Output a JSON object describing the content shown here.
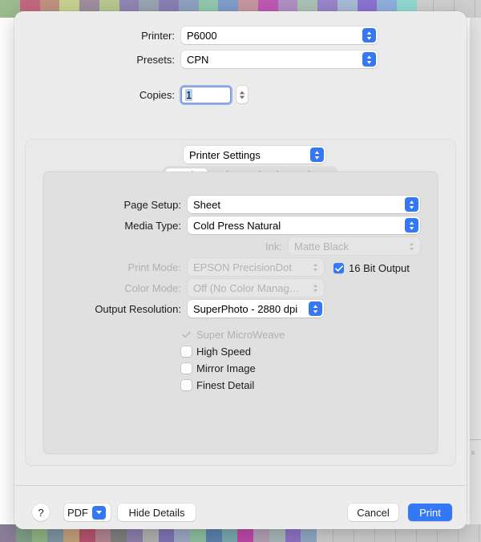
{
  "dialog": {
    "fields": [
      {
        "label": "Printer:",
        "value": "P6000",
        "enabled": true
      },
      {
        "label": "Presets:",
        "value": "CPN",
        "enabled": true
      }
    ],
    "copies": {
      "label": "Copies:",
      "value": "1"
    },
    "pane_selector": {
      "value": "Printer Settings"
    },
    "tabs": [
      {
        "label": "Basic",
        "selected": true
      },
      {
        "label": "Advanced Color Settings",
        "selected": false
      }
    ],
    "settings": [
      {
        "label": "Page Setup:",
        "value": "Sheet",
        "enabled": true
      },
      {
        "label": "Media Type:",
        "value": "Cold Press Natural",
        "enabled": true
      },
      {
        "label": "Ink:",
        "value": "Matte Black",
        "enabled": false
      },
      {
        "label": "Print Mode:",
        "value": "EPSON PrecisionDot",
        "enabled": false
      },
      {
        "label": "Color Mode:",
        "value": "Off (No Color Managem…",
        "enabled": false
      },
      {
        "label": "Output Resolution:",
        "value": "SuperPhoto - 2880 dpi",
        "enabled": true
      }
    ],
    "bit_output": {
      "label": "16 Bit Output",
      "checked": true,
      "enabled": true
    },
    "checkboxes": [
      {
        "label": "Super MicroWeave",
        "checked": true,
        "enabled": false
      },
      {
        "label": "High Speed",
        "checked": false,
        "enabled": true
      },
      {
        "label": "Mirror Image",
        "checked": false,
        "enabled": true
      },
      {
        "label": "Finest Detail",
        "checked": false,
        "enabled": true
      }
    ],
    "footer": {
      "help_label": "?",
      "pdf_label": "PDF",
      "details_label": "Hide Details",
      "cancel_label": "Cancel",
      "print_label": "Print"
    }
  },
  "backdrop": {
    "top_swatches": [
      "#9cbb8e",
      "#c4697f",
      "#c09380",
      "#c9d292",
      "#a08e9e",
      "#b7c98f",
      "#9086b4",
      "#9aa5b2",
      "#8a7fb4",
      "#8fa2c0",
      "#92c8ad",
      "#7f9ecb",
      "#c8979f",
      "#c059b5",
      "#b190c4",
      "#abc3b6",
      "#9a86c9",
      "#a8bcd4",
      "#8b73d4",
      "#8fb0dd",
      "#92d8d2"
    ],
    "bottom_swatches": [
      "#8a7e96",
      "#7f9e87",
      "#8fb584",
      "#7f96a3",
      "#c5a17b",
      "#b8536f",
      "#b38490",
      "#7f7f7f",
      "#8d80ae",
      "#b2b2b2",
      "#7f74b4",
      "#9fa9c4",
      "#8fc0a0",
      "#5d82ac",
      "#79aab1",
      "#bd4aa8",
      "#b4a0b6",
      "#a9b7ba",
      "#8f74c4",
      "#92a9c4"
    ],
    "accent": "#3478f6"
  }
}
